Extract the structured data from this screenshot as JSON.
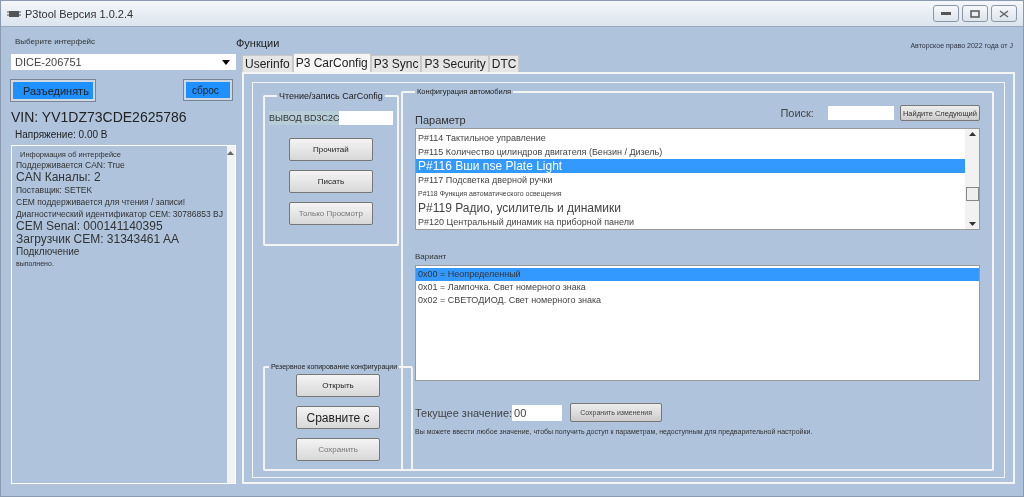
{
  "window": {
    "title": "P3tool Версия 1.0.2.4"
  },
  "interface": {
    "label": "Выберите интерфейс",
    "value": "DICE-206751"
  },
  "connection_buttons": [
    {
      "label": "Разъединять"
    },
    {
      "label": "сброс"
    }
  ],
  "vin": "VIN: YV1DZ73CDE2625786",
  "voltage": "Напряжение: 0.00 В",
  "log": {
    "title": "Информация об интерфейсе",
    "lines": [
      "Поддерживается CAN: True",
      "CAN Каналы: 2",
      "Поставщик: SETEK",
      "CEM поддерживается для чтения / записи!",
      "Диагностический идентификатор CEM: 30786853 BJ",
      "CEM Senal: 000141140395",
      "Загрузчик CEM: 31343461 AA",
      "Подключение",
      "выполнено."
    ]
  },
  "functions_label": "Функции",
  "copyright": "Авторское право 2022 года от J",
  "tabs": [
    {
      "label": "Userinfo",
      "selected": false
    },
    {
      "label": "P3 CarConfig",
      "selected": true
    },
    {
      "label": "P3 Sync",
      "selected": false
    },
    {
      "label": "P3 Security",
      "selected": false
    },
    {
      "label": "DTC",
      "selected": false
    }
  ],
  "carconfig_group": {
    "title": "Чтение/запись CarConfig",
    "output": "ВЫВОД BD3C2C",
    "buttons": [
      {
        "label": "Прочитай",
        "disabled": false
      },
      {
        "label": "Писать",
        "disabled": false
      },
      {
        "label": "Только Просмотр",
        "disabled": true
      }
    ]
  },
  "backup_group": {
    "title": "Резервное копирование конфигурации",
    "buttons": [
      {
        "label": "Открыть",
        "disabled": false
      },
      {
        "label": "Сравните с",
        "disabled": false
      },
      {
        "label": "Сохранить",
        "disabled": true
      }
    ]
  },
  "config_group": {
    "title": "Конфигурация автомобиля",
    "parameter_label": "Параметр",
    "search": {
      "label": "Поиск:",
      "button": "Найдите Следующий"
    },
    "parameters": [
      {
        "text": "P#114 Тактильное управление",
        "selected": false
      },
      {
        "text": "P#115 Количество цилиндров двигателя (Бензин / Дизель)",
        "selected": false
      },
      {
        "text": "P#116 Вши nse Plate Light",
        "selected": true
      },
      {
        "text": "P#117 Подсветка дверной ручки",
        "selected": false
      },
      {
        "text": "P#118 Функция автоматического освещения",
        "selected": false
      },
      {
        "text": "P#119 Радио, усилитель и динамики",
        "selected": false
      },
      {
        "text": "P#120 Центральный динамик на приборной панели",
        "selected": false
      }
    ],
    "variant_label": "Вариант",
    "variants": [
      {
        "text": "0x00 = Неопределенный",
        "selected": true
      },
      {
        "text": "0x01 = Лампочка. Свет номерного знака",
        "selected": false
      },
      {
        "text": "0x02 = СВЕТОДИОД. Свет номерного знака",
        "selected": false
      }
    ],
    "current_label": "Текущее значение:",
    "current_value": "00",
    "save_button": "Сохранить изменения",
    "hint": "Вы можете ввести любое значение, чтобы получить доступ к параметрам, недоступным для предварительной настройки."
  }
}
